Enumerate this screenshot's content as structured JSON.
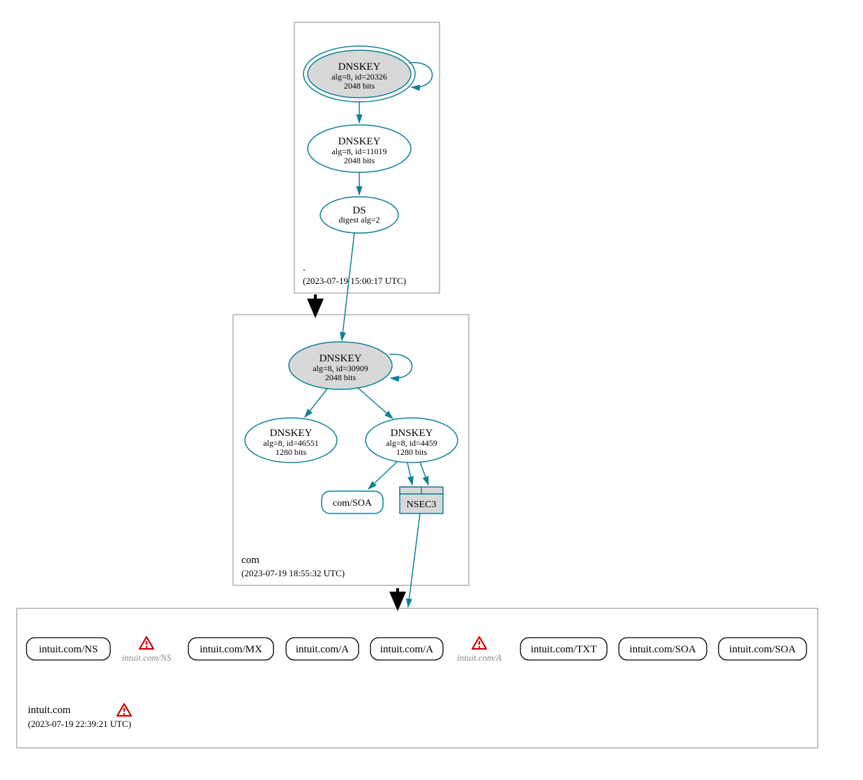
{
  "zones": {
    "root": {
      "name": ".",
      "timestamp": "(2023-07-19 15:00:17 UTC)"
    },
    "com": {
      "name": "com",
      "timestamp": "(2023-07-19 18:55:32 UTC)"
    },
    "intuit": {
      "name": "intuit.com",
      "timestamp": "(2023-07-19 22:39:21 UTC)"
    }
  },
  "nodes": {
    "root_ksk": {
      "title": "DNSKEY",
      "line2": "alg=8, id=20326",
      "line3": "2048 bits"
    },
    "root_zsk": {
      "title": "DNSKEY",
      "line2": "alg=8, id=11019",
      "line3": "2048 bits"
    },
    "root_ds": {
      "title": "DS",
      "line2": "digest alg=2"
    },
    "com_ksk": {
      "title": "DNSKEY",
      "line2": "alg=8, id=30909",
      "line3": "2048 bits"
    },
    "com_zsk1": {
      "title": "DNSKEY",
      "line2": "alg=8, id=46551",
      "line3": "1280 bits"
    },
    "com_zsk2": {
      "title": "DNSKEY",
      "line2": "alg=8, id=4459",
      "line3": "1280 bits"
    },
    "com_soa": {
      "title": "com/SOA"
    },
    "nsec3": {
      "title": "NSEC3"
    }
  },
  "records": {
    "r1": "intuit.com/NS",
    "r2": "intuit.com/NS",
    "r3": "intuit.com/MX",
    "r4": "intuit.com/A",
    "r5": "intuit.com/A",
    "r6": "intuit.com/A",
    "r7": "intuit.com/TXT",
    "r8": "intuit.com/SOA",
    "r9": "intuit.com/SOA"
  }
}
